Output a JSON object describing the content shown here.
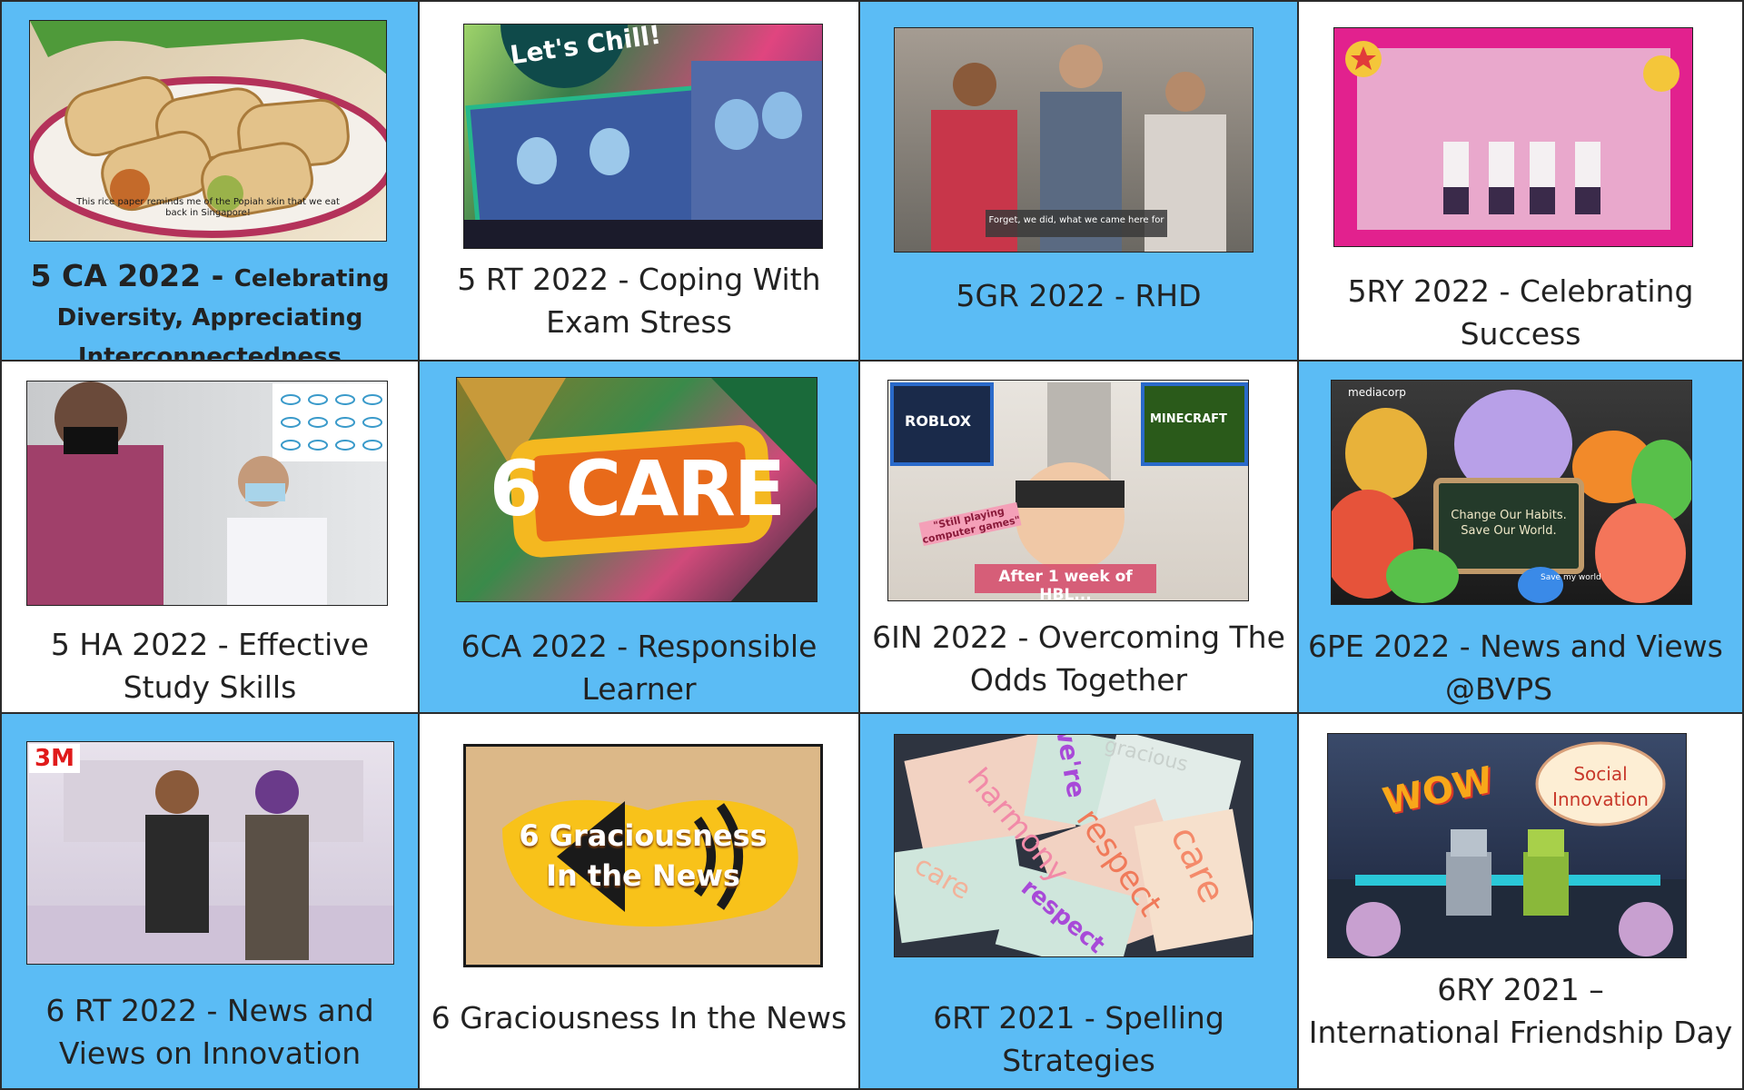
{
  "cells": [
    {
      "id": 1,
      "caption_strong": "5 CA 2022 - ",
      "caption_small": "Celebrating Diversity, Appreciating Interconnectedness",
      "thumb_subtitle": "This rice paper reminds me of the Popiah skin that we eat back in Singapore!"
    },
    {
      "id": 2,
      "caption": "5 RT 2022 - Coping With Exam Stress",
      "thumb_text": "Let's Chill!"
    },
    {
      "id": 3,
      "caption": "5GR 2022 - RHD",
      "thumb_subtitle": "Forget, we did, what we came here for"
    },
    {
      "id": 4,
      "caption": "5RY 2022 - Celebrating Success"
    },
    {
      "id": 5,
      "caption": "5 HA 2022 - Effective Study Skills"
    },
    {
      "id": 6,
      "caption": "6CA 2022 - Responsible Learner",
      "thumb_text": "6 CARE"
    },
    {
      "id": 7,
      "caption": "6IN 2022 - Overcoming The Odds Together",
      "thumb_left_badge": "ROBLOX",
      "thumb_right_badge": "MINECRAFT",
      "thumb_note": "\"Still playing computer games\"",
      "thumb_banner": "After 1 week of HBL..."
    },
    {
      "id": 8,
      "caption_line1": "6PE 2022 - News and Views",
      "caption_line2": "@BVPS",
      "thumb_logo": "mediacorp",
      "thumb_board": "Change Our Habits. Save Our World.",
      "thumb_small": "Save my world"
    },
    {
      "id": 9,
      "caption": "6 RT 2022 - News and Views on Innovation",
      "thumb_logo": "3M"
    },
    {
      "id": 10,
      "caption": "6 Graciousness In the News",
      "thumb_line1": "6 Graciousness",
      "thumb_line2": "In the News"
    },
    {
      "id": 11,
      "caption": "6RT 2021 - Spelling Strategies",
      "thumb_words": [
        "harmony",
        "we're",
        "gracious",
        "respect",
        "care",
        "care",
        "respect"
      ]
    },
    {
      "id": 12,
      "caption_line1": "6RY 2021 –",
      "caption_line2": "International Friendship Day",
      "thumb_wow": "WOW",
      "thumb_bubble": "Social Innovation"
    }
  ],
  "colors": {
    "blue_cell": "#5bbcf5",
    "white_cell": "#ffffff",
    "border": "#2b2b2b"
  }
}
